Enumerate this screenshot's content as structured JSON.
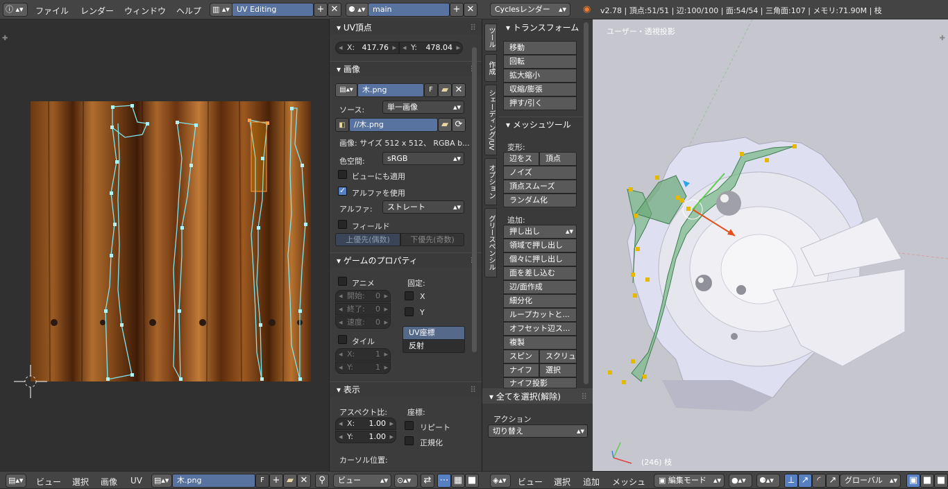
{
  "top": {
    "menus": [
      "ファイル",
      "レンダー",
      "ウィンドウ",
      "ヘルプ"
    ],
    "layout_name": "UV Editing",
    "scene_name": "main",
    "render_engine": "Cyclesレンダー",
    "stats": "v2.78 | 頂点:51/51 | 辺:100/100 | 面:54/54 | 三角面:107 | メモリ:71.90M | 枝"
  },
  "uv_panel": {
    "uv_vertex": {
      "title": "UV頂点",
      "x_label": "X:",
      "x_value": "417.76",
      "y_label": "Y:",
      "y_value": "478.04"
    },
    "image": {
      "title": "画像",
      "name": "木.png",
      "fake_user": "F",
      "source_label": "ソース:",
      "source_value": "単一画像",
      "filepath": "//木.png",
      "info": "画像: サイズ 512 x 512、 RGBA b...",
      "colorspace_label": "色空間:",
      "colorspace_value": "sRGB",
      "view_as_render": "ビューにも適用",
      "use_alpha": "アルファを使用",
      "alpha_label": "アルファ:",
      "alpha_value": "ストレート",
      "fields": "フィールド",
      "upper_first": "上優先(偶数)",
      "lower_first": "下優先(奇数)"
    },
    "game": {
      "title": "ゲームのプロパティ",
      "animate": "アニメ",
      "clamp_label": "固定:",
      "start_label": "開始:",
      "start_value": "0",
      "end_label": "終了:",
      "end_value": "0",
      "speed_label": "速度:",
      "speed_value": "0",
      "clamp_x": "X",
      "clamp_y": "Y",
      "mapping_uv": "UV座標",
      "mapping_reflect": "反射",
      "tiles": "タイル",
      "tile_x_label": "X:",
      "tile_x_value": "1",
      "tile_y_label": "Y:",
      "tile_y_value": "1"
    },
    "display": {
      "title": "表示",
      "aspect_label": "アスペクト比:",
      "coords_label": "座標:",
      "ax_label": "X:",
      "ax_value": "1.00",
      "ay_label": "Y:",
      "ay_value": "1.00",
      "repeat": "リピート",
      "normalized": "正規化",
      "cursor_label": "カーソル位置:"
    }
  },
  "uv_footer": {
    "menus": [
      "ビュー",
      "選択",
      "画像",
      "UV"
    ],
    "image_name": "木.png",
    "fake": "F",
    "view_mode": "ビュー"
  },
  "tool_shelf": {
    "tabs": [
      "ツール",
      "作成",
      "シェーディング/UV",
      "オプション",
      "グリースペンシル"
    ],
    "transform_title": "トランスフォーム",
    "transform_items": [
      "移動",
      "回転",
      "拡大縮小",
      "収縮/膨張",
      "押す/引く"
    ],
    "mesh_tools_title": "メッシュツール",
    "deform_label": "変形:",
    "slide_edge": "辺をス",
    "slide_vertex": "頂点",
    "noise": "ノイズ",
    "smooth_vertex": "頂点スムーズ",
    "randomize": "ランダム化",
    "add_label": "追加:",
    "extrude": "押し出し",
    "add_items": [
      "領域で押し出し",
      "個々に押し出し",
      "面を差し込む",
      "辺/面作成",
      "細分化",
      "ループカットと...",
      "オフセット辺ス...",
      "複製"
    ],
    "spin": "スピン",
    "screw": "スクリュ",
    "knife": "ナイフ",
    "select": "選択",
    "knife_project": "ナイフ投影",
    "operator_title": "全てを選択(解除)",
    "action_label": "アクション",
    "action_value": "切り替え"
  },
  "viewport": {
    "view_name": "ユーザー・透視投影",
    "object_info": "(246) 枝"
  },
  "view3d_footer": {
    "menus": [
      "ビュー",
      "選択",
      "追加",
      "メッシュ"
    ],
    "mode": "編集モード",
    "orientation": "グローバル"
  }
}
